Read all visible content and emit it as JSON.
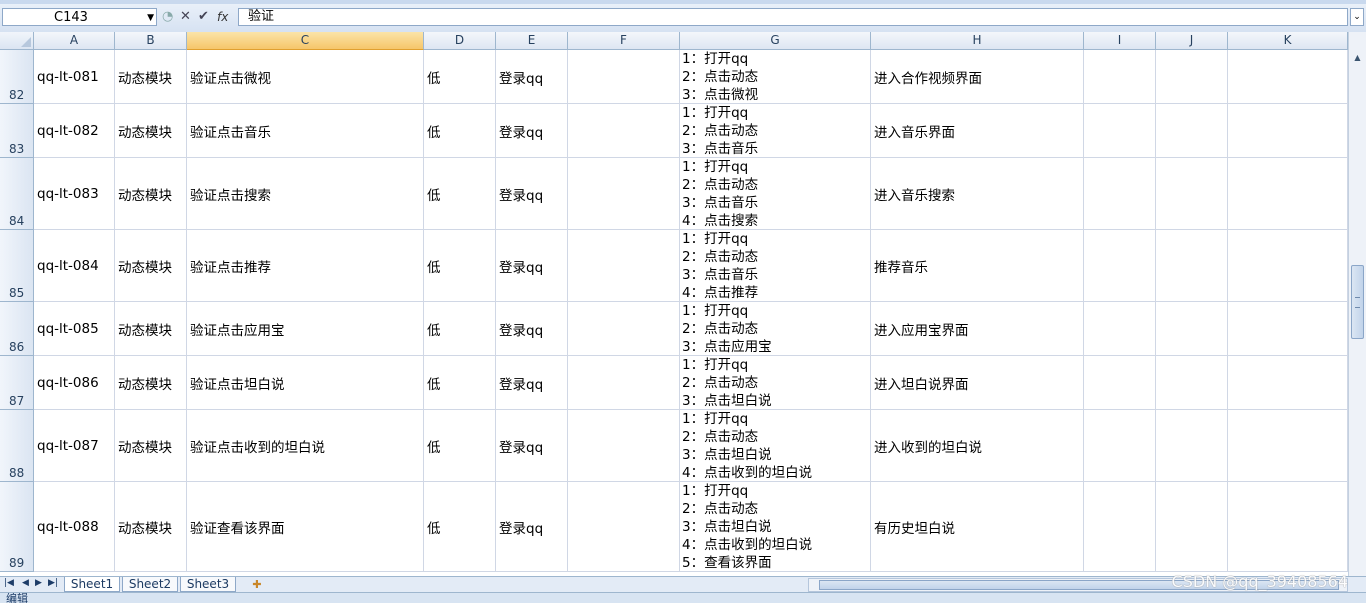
{
  "formula_bar": {
    "name_box": "C143",
    "function_icon": "fx",
    "content": "验证"
  },
  "columns": [
    "A",
    "B",
    "C",
    "D",
    "E",
    "F",
    "G",
    "H",
    "I",
    "J",
    "K"
  ],
  "selected_column": "C",
  "rows": [
    {
      "num": "82",
      "a": "qq-lt-081",
      "b": "动态模块",
      "c": "验证点击微视",
      "d": "低",
      "e": "登录qq",
      "f": "",
      "g": [
        "1：打开qq",
        "2：点击动态",
        "3：点击微视"
      ],
      "h": "进入合作视频界面"
    },
    {
      "num": "83",
      "a": "qq-lt-082",
      "b": "动态模块",
      "c": "验证点击音乐",
      "d": "低",
      "e": "登录qq",
      "f": "",
      "g": [
        "1：打开qq",
        "2：点击动态",
        "3：点击音乐"
      ],
      "h": "进入音乐界面"
    },
    {
      "num": "84",
      "a": "qq-lt-083",
      "b": "动态模块",
      "c": "验证点击搜索",
      "d": "低",
      "e": "登录qq",
      "f": "",
      "g": [
        "1：打开qq",
        "2：点击动态",
        "3：点击音乐",
        "4：点击搜索"
      ],
      "h": "进入音乐搜索"
    },
    {
      "num": "85",
      "a": "qq-lt-084",
      "b": "动态模块",
      "c": "验证点击推荐",
      "d": "低",
      "e": "登录qq",
      "f": "",
      "g": [
        "1：打开qq",
        "2：点击动态",
        "3：点击音乐",
        "4：点击推荐"
      ],
      "h": "推荐音乐"
    },
    {
      "num": "86",
      "a": "qq-lt-085",
      "b": "动态模块",
      "c": "验证点击应用宝",
      "d": "低",
      "e": "登录qq",
      "f": "",
      "g": [
        "1：打开qq",
        "2：点击动态",
        "3：点击应用宝"
      ],
      "h": "进入应用宝界面"
    },
    {
      "num": "87",
      "a": "qq-lt-086",
      "b": "动态模块",
      "c": "验证点击坦白说",
      "d": "低",
      "e": "登录qq",
      "f": "",
      "g": [
        "1：打开qq",
        "2：点击动态",
        "3：点击坦白说"
      ],
      "h": "进入坦白说界面"
    },
    {
      "num": "88",
      "a": "qq-lt-087",
      "b": "动态模块",
      "c": "验证点击收到的坦白说",
      "d": "低",
      "e": "登录qq",
      "f": "",
      "g": [
        "1：打开qq",
        "2：点击动态",
        "3：点击坦白说",
        "4：点击收到的坦白说"
      ],
      "h": "进入收到的坦白说"
    },
    {
      "num": "89",
      "a": "qq-lt-088",
      "b": "动态模块",
      "c": "验证查看该界面",
      "d": "低",
      "e": "登录qq",
      "f": "",
      "g": [
        "1：打开qq",
        "2：点击动态",
        "3：点击坦白说",
        "4：点击收到的坦白说",
        "5：查看该界面"
      ],
      "h": "有历史坦白说"
    }
  ],
  "sheets": [
    "Sheet1",
    "Sheet2",
    "Sheet3"
  ],
  "active_sheet": "Sheet1",
  "status_text": "编辑",
  "watermark": "CSDN @qq_39408564"
}
